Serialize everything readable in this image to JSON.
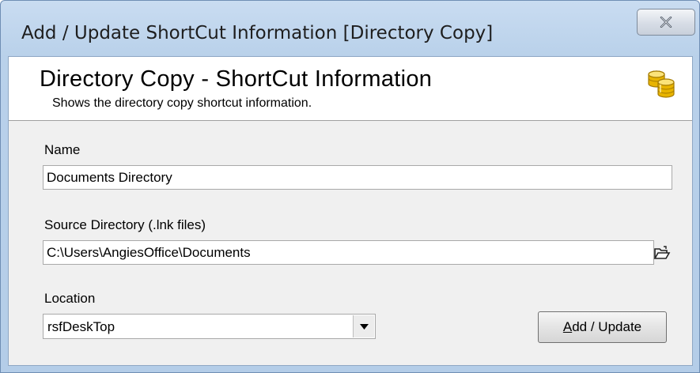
{
  "window": {
    "title": "Add / Update ShortCut Information [Directory Copy]",
    "close_icon": "close-icon"
  },
  "header": {
    "title": "Directory Copy - ShortCut Information",
    "subtitle": "Shows the directory copy shortcut information.",
    "icon": "database-coins-icon"
  },
  "form": {
    "name_label": "Name",
    "name_value": "Documents Directory",
    "source_label": "Source Directory (.lnk files)",
    "source_value": "C:\\Users\\AngiesOffice\\Documents",
    "browse_icon": "open-folder-icon",
    "location_label": "Location",
    "location_value": "rsfDeskTop",
    "add_update_mnemonic": "A",
    "add_update_rest": "dd / Update"
  },
  "colors": {
    "title_bar": "#b9d1ea",
    "client_bg": "#f0f0f0",
    "header_bg": "#ffffff",
    "icon_gold": "#e8b400"
  }
}
